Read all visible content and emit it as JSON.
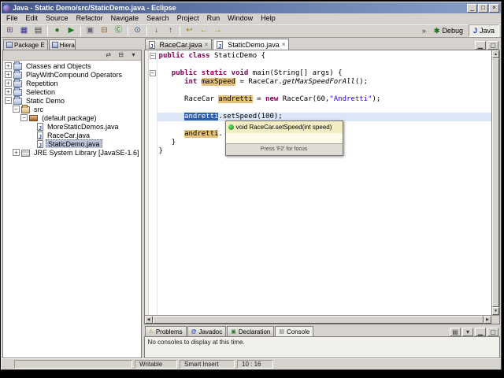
{
  "window": {
    "title": "Java - Static Demo/src/StaticDemo.java - Eclipse",
    "controls": [
      {
        "name": "minimize",
        "glyph": "_"
      },
      {
        "name": "maximize",
        "glyph": "□"
      },
      {
        "name": "close",
        "glyph": "×"
      }
    ]
  },
  "menu_bar": {
    "items": [
      "File",
      "Edit",
      "Source",
      "Refactor",
      "Navigate",
      "Search",
      "Project",
      "Run",
      "Window",
      "Help"
    ]
  },
  "icons": {
    "scroll_up": "▲",
    "scroll_down": "▼",
    "scroll_left": "◀",
    "scroll_right": "▶",
    "tab_close": "×",
    "overflow": "»"
  },
  "toolbar": {
    "groups": [
      [
        {
          "name": "new-wizard",
          "glyph": "⊞"
        },
        {
          "name": "save",
          "glyph": "▦"
        },
        {
          "name": "print",
          "glyph": "▤"
        }
      ],
      [
        {
          "name": "debug",
          "glyph": "●"
        },
        {
          "name": "run",
          "glyph": "▶"
        }
      ],
      [
        {
          "name": "new-java-project",
          "glyph": "▣"
        },
        {
          "name": "new-package",
          "glyph": "⊟"
        },
        {
          "name": "new-class",
          "glyph": "Ⓒ"
        }
      ],
      [
        {
          "name": "search",
          "glyph": "⊙"
        }
      ],
      [
        {
          "name": "next-annotation",
          "glyph": "↓"
        },
        {
          "name": "previous-annotation",
          "glyph": "↑"
        }
      ],
      [
        {
          "name": "last-edit-location",
          "glyph": "↩"
        },
        {
          "name": "back",
          "glyph": "←"
        },
        {
          "name": "forward",
          "glyph": "→"
        }
      ]
    ],
    "perspectives": [
      {
        "name": "debug",
        "label": "Debug",
        "glyph": "✱",
        "active": false
      },
      {
        "name": "java",
        "label": "Java",
        "glyph": "J",
        "active": true
      }
    ]
  },
  "package_explorer": {
    "tabs": [
      {
        "label": "Package E",
        "active": true
      },
      {
        "label": "Hierarchy",
        "active": false
      }
    ],
    "view_buttons": [
      {
        "name": "link-with-editor",
        "glyph": "⇄"
      },
      {
        "name": "collapse-all",
        "glyph": "⊟"
      },
      {
        "name": "view-menu",
        "glyph": "▾"
      }
    ],
    "tree": [
      {
        "label": "Classes and Objects",
        "depth": 0,
        "expander": "+",
        "icon": "project"
      },
      {
        "label": "PlayWithCompound Operators",
        "depth": 0,
        "expander": "+",
        "icon": "project"
      },
      {
        "label": "Repetition",
        "depth": 0,
        "expander": "+",
        "icon": "project"
      },
      {
        "label": "Selection",
        "depth": 0,
        "expander": "+",
        "icon": "project"
      },
      {
        "label": "Static Demo",
        "depth": 0,
        "expander": "-",
        "icon": "project"
      },
      {
        "label": "src",
        "depth": 1,
        "expander": "-",
        "icon": "srcfolder"
      },
      {
        "label": "(default package)",
        "depth": 2,
        "expander": "-",
        "icon": "package"
      },
      {
        "label": "MoreStaticDemos.java",
        "depth": 3,
        "expander": "",
        "icon": "jfile"
      },
      {
        "label": "RaceCar.java",
        "depth": 3,
        "expander": "",
        "icon": "jfile"
      },
      {
        "label": "StaticDemo.java",
        "depth": 3,
        "expander": "",
        "icon": "jfile",
        "selected": true
      },
      {
        "label": "JRE System Library [JavaSE-1.6]",
        "depth": 1,
        "expander": "+",
        "icon": "library"
      }
    ]
  },
  "editor": {
    "tabs": [
      {
        "label": "RaceCar.java",
        "active": false
      },
      {
        "label": "StaticDemo.java",
        "active": true
      }
    ],
    "view_buttons": [
      {
        "name": "minimize-editor",
        "glyph": "▁"
      },
      {
        "name": "maximize-editor",
        "glyph": "▢"
      }
    ],
    "code": [
      {
        "fold": "-",
        "tokens": [
          {
            "s": "kw",
            "t": "public class "
          },
          {
            "s": "pl",
            "t": "StaticDemo {"
          }
        ]
      },
      {
        "tokens": []
      },
      {
        "fold": "-",
        "tokens": [
          {
            "s": "pl",
            "t": "   "
          },
          {
            "s": "kw",
            "t": "public static void "
          },
          {
            "s": "pl",
            "t": "main(String[] args) {"
          }
        ]
      },
      {
        "tokens": [
          {
            "s": "pl",
            "t": "      "
          },
          {
            "s": "kw",
            "t": "int "
          },
          {
            "s": "occ",
            "t": "maxSpeed"
          },
          {
            "s": "pl",
            "t": " = RaceCar."
          },
          {
            "s": "st",
            "t": "getMaxSpeedForAll"
          },
          {
            "s": "pl",
            "t": "();"
          }
        ]
      },
      {
        "tokens": []
      },
      {
        "tokens": [
          {
            "s": "pl",
            "t": "      RaceCar "
          },
          {
            "s": "occ",
            "t": "andretti"
          },
          {
            "s": "pl",
            "t": " = "
          },
          {
            "s": "kw",
            "t": "new "
          },
          {
            "s": "pl",
            "t": "RaceCar(60,"
          },
          {
            "s": "str",
            "t": "\"Andretti\""
          },
          {
            "s": "pl",
            "t": ");"
          }
        ]
      },
      {
        "tokens": []
      },
      {
        "current": true,
        "tokens": [
          {
            "s": "pl",
            "t": "      "
          },
          {
            "s": "sel",
            "t": "andretti"
          },
          {
            "s": "pl",
            "t": ".setSpeed(100);"
          }
        ]
      },
      {
        "tokens": []
      },
      {
        "tokens": [
          {
            "s": "pl",
            "t": "      "
          },
          {
            "s": "occ",
            "t": "andretti"
          },
          {
            "s": "pl",
            "t": "."
          }
        ]
      },
      {
        "tokens": [
          {
            "s": "pl",
            "t": "   }"
          }
        ]
      },
      {
        "tokens": [
          {
            "s": "pl",
            "t": "}"
          }
        ]
      }
    ]
  },
  "completion": {
    "items": [
      {
        "label": "void RaceCar.setSpeed(int speed)",
        "icon": "public-method",
        "selected": true
      }
    ],
    "footer": "Press 'F2' for focus"
  },
  "console": {
    "tabs": [
      {
        "label": "Problems",
        "icon": "problems",
        "glyph": "⚠",
        "active": false
      },
      {
        "label": "Javadoc",
        "icon": "javadoc",
        "glyph": "@",
        "active": false
      },
      {
        "label": "Declaration",
        "icon": "declaration",
        "glyph": "▣",
        "active": false
      },
      {
        "label": "Console",
        "icon": "console",
        "glyph": "▤",
        "active": true
      }
    ],
    "view_buttons": [
      {
        "name": "open-console",
        "glyph": "▤"
      },
      {
        "name": "console-view-menu",
        "glyph": "▾"
      },
      {
        "name": "minimize-view",
        "glyph": "▁"
      },
      {
        "name": "maximize-view",
        "glyph": "▢"
      }
    ],
    "message": "No consoles to display at this time."
  },
  "status_bar": {
    "writable": "Writable",
    "insert_mode": "Smart Insert",
    "cursor_position": "10 : 16"
  }
}
